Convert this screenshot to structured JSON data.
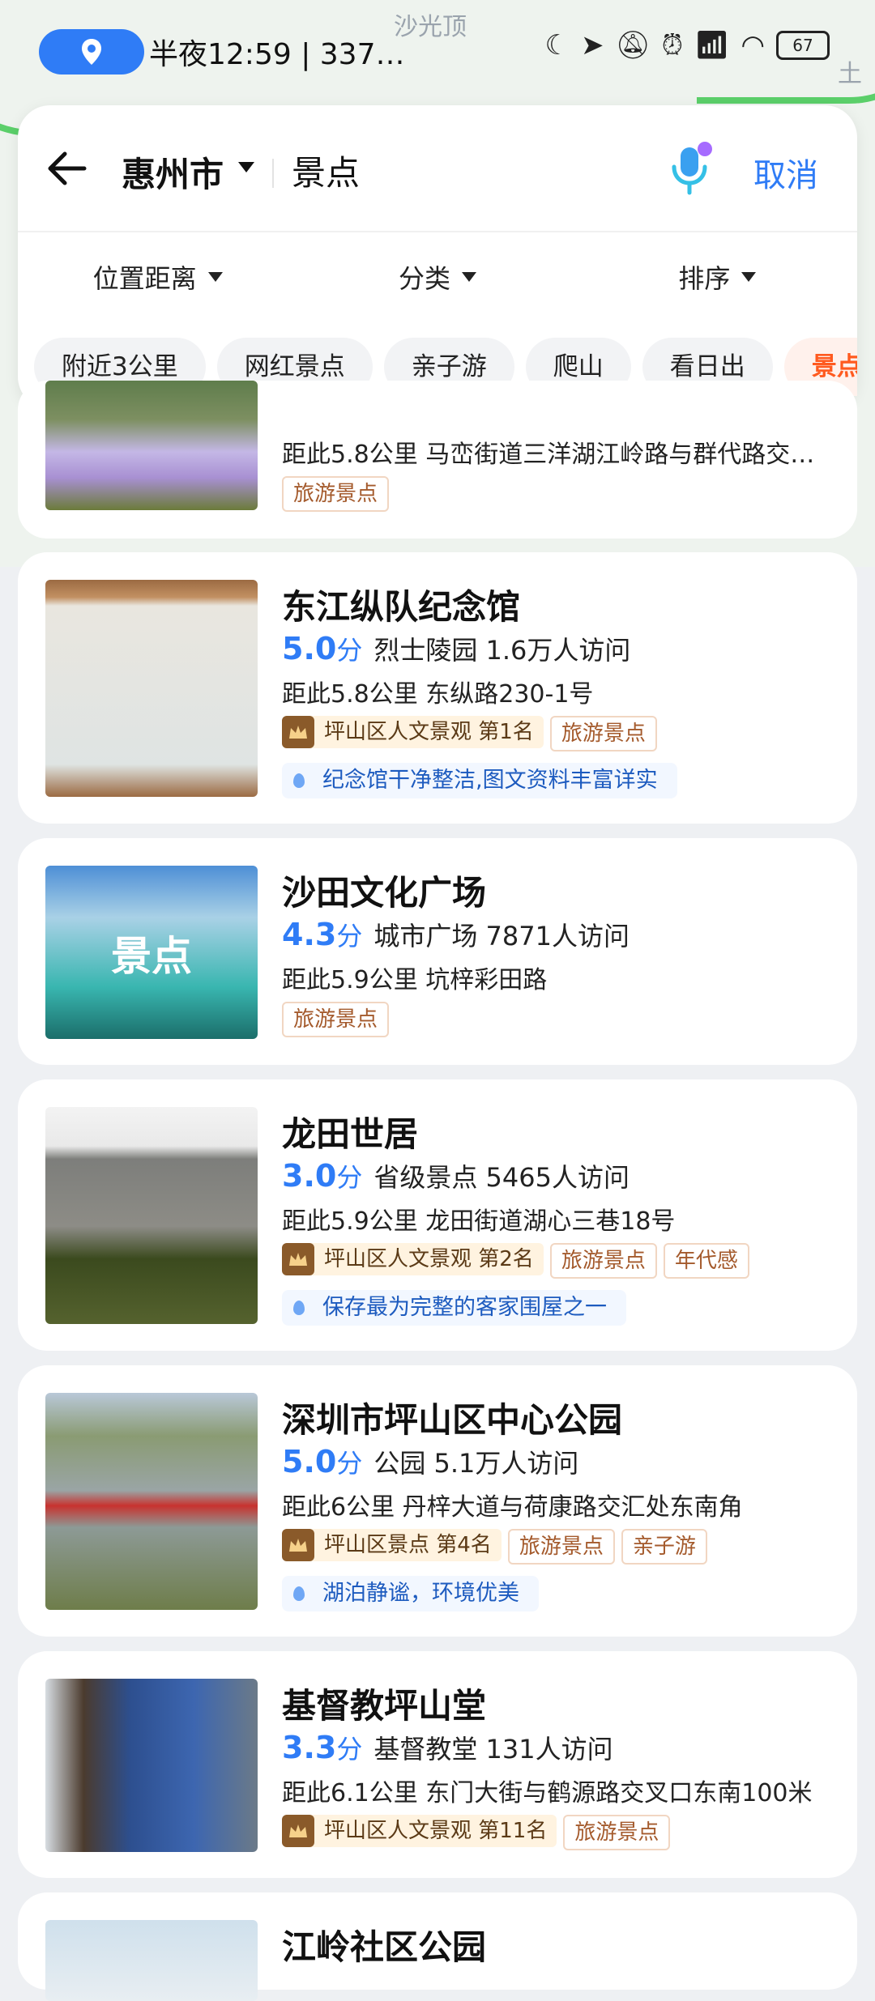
{
  "status_bar": {
    "time_text": "半夜12:59 | 337…",
    "battery": "67"
  },
  "map": {
    "labels": [
      "沙光顶",
      "土"
    ]
  },
  "search": {
    "city": "惠州市",
    "query": "景点",
    "cancel_label": "取消"
  },
  "filters": [
    {
      "label": "位置距离"
    },
    {
      "label": "分类"
    },
    {
      "label": "排序"
    }
  ],
  "chips": [
    "附近3公里",
    "网红景点",
    "亲子游",
    "爬山",
    "看日出",
    "景点"
  ],
  "results": [
    {
      "title": "",
      "meta_line": "",
      "distance": "距此5.8公里 马峦街道三洋湖江岭路与群代路交…",
      "tags": [
        "旅游景点"
      ]
    },
    {
      "title": "东江纵队纪念馆",
      "score": "5.0",
      "score_unit": "分",
      "category": "烈士陵园 1.6万人访问",
      "distance": "距此5.8公里 东纵路230-1号",
      "rank": "坪山区人文景观 第1名",
      "tags": [
        "旅游景点"
      ],
      "review": "纪念馆干净整洁,图文资料丰富详实"
    },
    {
      "title": "沙田文化广场",
      "score": "4.3",
      "score_unit": "分",
      "category": "城市广场 7871人访问",
      "distance": "距此5.9公里 坑梓彩田路",
      "tags": [
        "旅游景点"
      ],
      "thumb_text": "景点"
    },
    {
      "title": "龙田世居",
      "score": "3.0",
      "score_unit": "分",
      "category": "省级景点 5465人访问",
      "distance": "距此5.9公里 龙田街道湖心三巷18号",
      "rank": "坪山区人文景观 第2名",
      "tags": [
        "旅游景点",
        "年代感"
      ],
      "review": "保存最为完整的客家围屋之一"
    },
    {
      "title": "深圳市坪山区中心公园",
      "score": "5.0",
      "score_unit": "分",
      "category": "公园 5.1万人访问",
      "distance": "距此6公里 丹梓大道与荷康路交汇处东南角",
      "rank": "坪山区景点 第4名",
      "tags": [
        "旅游景点",
        "亲子游"
      ],
      "review": "湖泊静谧，环境优美"
    },
    {
      "title": "基督教坪山堂",
      "score": "3.3",
      "score_unit": "分",
      "category": "基督教堂 131人访问",
      "distance": "距此6.1公里 东门大街与鹤源路交叉口东南100米",
      "rank": "坪山区人文景观 第11名",
      "tags": [
        "旅游景点"
      ]
    },
    {
      "title": "江岭社区公园"
    }
  ],
  "colors": {
    "accent": "#2f7cf6",
    "chip_active": "#ff5a1f",
    "tag_border": "#f1d6c2"
  }
}
